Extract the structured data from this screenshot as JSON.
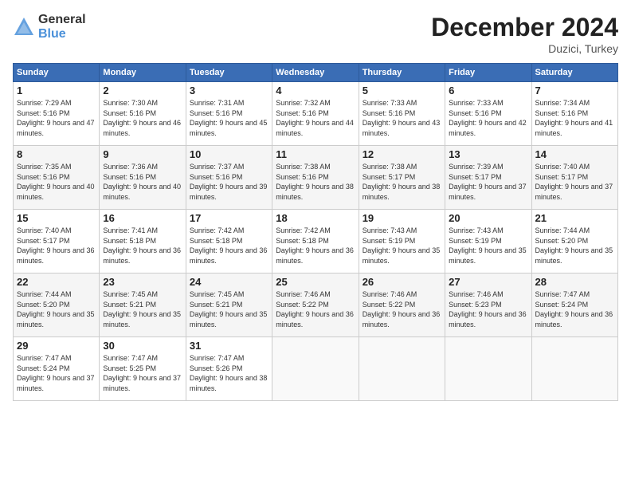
{
  "logo": {
    "general": "General",
    "blue": "Blue"
  },
  "title": "December 2024",
  "location": "Duzici, Turkey",
  "days_of_week": [
    "Sunday",
    "Monday",
    "Tuesday",
    "Wednesday",
    "Thursday",
    "Friday",
    "Saturday"
  ],
  "weeks": [
    [
      {
        "day": "1",
        "sunrise": "7:29 AM",
        "sunset": "5:16 PM",
        "daylight": "9 hours and 47 minutes."
      },
      {
        "day": "2",
        "sunrise": "7:30 AM",
        "sunset": "5:16 PM",
        "daylight": "9 hours and 46 minutes."
      },
      {
        "day": "3",
        "sunrise": "7:31 AM",
        "sunset": "5:16 PM",
        "daylight": "9 hours and 45 minutes."
      },
      {
        "day": "4",
        "sunrise": "7:32 AM",
        "sunset": "5:16 PM",
        "daylight": "9 hours and 44 minutes."
      },
      {
        "day": "5",
        "sunrise": "7:33 AM",
        "sunset": "5:16 PM",
        "daylight": "9 hours and 43 minutes."
      },
      {
        "day": "6",
        "sunrise": "7:33 AM",
        "sunset": "5:16 PM",
        "daylight": "9 hours and 42 minutes."
      },
      {
        "day": "7",
        "sunrise": "7:34 AM",
        "sunset": "5:16 PM",
        "daylight": "9 hours and 41 minutes."
      }
    ],
    [
      {
        "day": "8",
        "sunrise": "7:35 AM",
        "sunset": "5:16 PM",
        "daylight": "9 hours and 40 minutes."
      },
      {
        "day": "9",
        "sunrise": "7:36 AM",
        "sunset": "5:16 PM",
        "daylight": "9 hours and 40 minutes."
      },
      {
        "day": "10",
        "sunrise": "7:37 AM",
        "sunset": "5:16 PM",
        "daylight": "9 hours and 39 minutes."
      },
      {
        "day": "11",
        "sunrise": "7:38 AM",
        "sunset": "5:16 PM",
        "daylight": "9 hours and 38 minutes."
      },
      {
        "day": "12",
        "sunrise": "7:38 AM",
        "sunset": "5:17 PM",
        "daylight": "9 hours and 38 minutes."
      },
      {
        "day": "13",
        "sunrise": "7:39 AM",
        "sunset": "5:17 PM",
        "daylight": "9 hours and 37 minutes."
      },
      {
        "day": "14",
        "sunrise": "7:40 AM",
        "sunset": "5:17 PM",
        "daylight": "9 hours and 37 minutes."
      }
    ],
    [
      {
        "day": "15",
        "sunrise": "7:40 AM",
        "sunset": "5:17 PM",
        "daylight": "9 hours and 36 minutes."
      },
      {
        "day": "16",
        "sunrise": "7:41 AM",
        "sunset": "5:18 PM",
        "daylight": "9 hours and 36 minutes."
      },
      {
        "day": "17",
        "sunrise": "7:42 AM",
        "sunset": "5:18 PM",
        "daylight": "9 hours and 36 minutes."
      },
      {
        "day": "18",
        "sunrise": "7:42 AM",
        "sunset": "5:18 PM",
        "daylight": "9 hours and 36 minutes."
      },
      {
        "day": "19",
        "sunrise": "7:43 AM",
        "sunset": "5:19 PM",
        "daylight": "9 hours and 35 minutes."
      },
      {
        "day": "20",
        "sunrise": "7:43 AM",
        "sunset": "5:19 PM",
        "daylight": "9 hours and 35 minutes."
      },
      {
        "day": "21",
        "sunrise": "7:44 AM",
        "sunset": "5:20 PM",
        "daylight": "9 hours and 35 minutes."
      }
    ],
    [
      {
        "day": "22",
        "sunrise": "7:44 AM",
        "sunset": "5:20 PM",
        "daylight": "9 hours and 35 minutes."
      },
      {
        "day": "23",
        "sunrise": "7:45 AM",
        "sunset": "5:21 PM",
        "daylight": "9 hours and 35 minutes."
      },
      {
        "day": "24",
        "sunrise": "7:45 AM",
        "sunset": "5:21 PM",
        "daylight": "9 hours and 35 minutes."
      },
      {
        "day": "25",
        "sunrise": "7:46 AM",
        "sunset": "5:22 PM",
        "daylight": "9 hours and 36 minutes."
      },
      {
        "day": "26",
        "sunrise": "7:46 AM",
        "sunset": "5:22 PM",
        "daylight": "9 hours and 36 minutes."
      },
      {
        "day": "27",
        "sunrise": "7:46 AM",
        "sunset": "5:23 PM",
        "daylight": "9 hours and 36 minutes."
      },
      {
        "day": "28",
        "sunrise": "7:47 AM",
        "sunset": "5:24 PM",
        "daylight": "9 hours and 36 minutes."
      }
    ],
    [
      {
        "day": "29",
        "sunrise": "7:47 AM",
        "sunset": "5:24 PM",
        "daylight": "9 hours and 37 minutes."
      },
      {
        "day": "30",
        "sunrise": "7:47 AM",
        "sunset": "5:25 PM",
        "daylight": "9 hours and 37 minutes."
      },
      {
        "day": "31",
        "sunrise": "7:47 AM",
        "sunset": "5:26 PM",
        "daylight": "9 hours and 38 minutes."
      },
      null,
      null,
      null,
      null
    ]
  ]
}
